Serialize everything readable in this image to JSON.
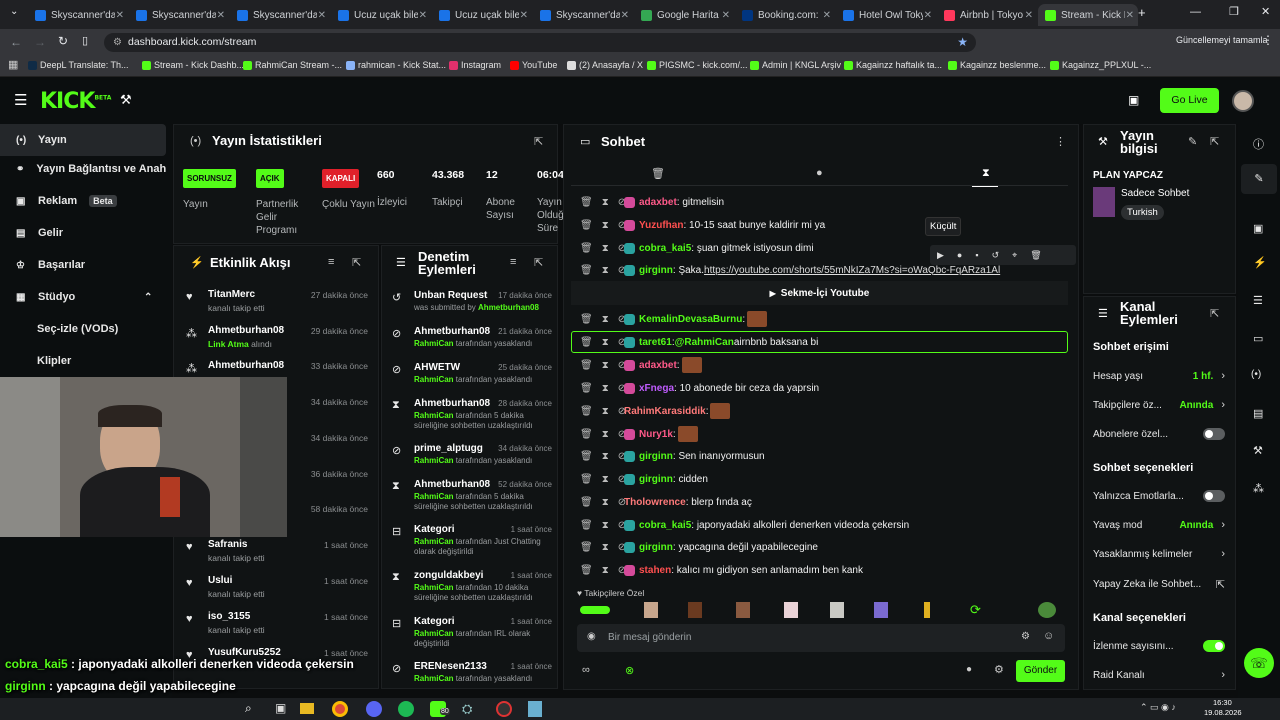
{
  "browser": {
    "tabs": [
      "Skyscanner'da",
      "Skyscanner'da",
      "Skyscanner'da",
      "Ucuz uçak bile",
      "Ucuz uçak bile",
      "Skyscanner'da",
      "Google Harita",
      "Booking.com: I",
      "Hotel Owl Toky",
      "Airbnb | Tokyo",
      "Stream - Kick D"
    ],
    "url": "dashboard.kick.com/stream",
    "update_label": "Güncellemeyi tamamla",
    "bookmarks": [
      "DeepL Translate: Th...",
      "Stream - Kick Dashb...",
      "RahmiCan Stream -...",
      "rahmican - Kick Stat...",
      "Instagram",
      "YouTube",
      "(2) Anasayfa / X",
      "PIGSMC - kick.com/...",
      "Admin | KNGL Arşiv",
      "Kagainzz haftalık ta...",
      "Kagainzz beslenme...",
      "Kagainzz_PPLXUL -..."
    ]
  },
  "header": {
    "logo": "KICK",
    "logo_sup": "BETA",
    "golive": "Go Live"
  },
  "sidebar": {
    "items": [
      "Yayın",
      "Yayın Bağlantısı ve Anahtarı",
      "Reklam",
      "Gelir",
      "Başarılar",
      "Stüdyo",
      "Seç-izle (VODs)",
      "Klipler"
    ],
    "beta": "Beta"
  },
  "stats": {
    "title": "Yayın İstatistikleri",
    "cols": [
      {
        "badge": "SORUNSUZ",
        "label": "Yayın"
      },
      {
        "badge": "AÇIK",
        "label": "Partnerlik Gelir Programı"
      },
      {
        "badge": "KAPALI",
        "label": "Çoklu Yayın"
      },
      {
        "num": "660",
        "label": "İzleyici"
      },
      {
        "num": "43.368",
        "label": "Takipçi"
      },
      {
        "num": "12",
        "label": "Abone Sayısı"
      },
      {
        "num": "06:04",
        "label": "Yayın Olduğu Süre"
      }
    ]
  },
  "events": {
    "title": "Etkinlik Akışı",
    "items": [
      {
        "name": "TitanMerc",
        "time": "27 dakika önce",
        "sub": "kanalı takip etti",
        "hl": ""
      },
      {
        "name": "Ahmetburhan08",
        "time": "29 dakika önce",
        "sub": "alındı",
        "hl": "Link Atma"
      },
      {
        "name": "Ahmetburhan08",
        "time": "33 dakika önce",
        "sub": "",
        "hl": ""
      },
      {
        "name": "",
        "time": "34 dakika önce",
        "sub": "",
        "hl": ""
      },
      {
        "name": "",
        "time": "34 dakika önce",
        "sub": "",
        "hl": ""
      },
      {
        "name": "",
        "time": "36 dakika önce",
        "sub": "",
        "hl": ""
      },
      {
        "name": "",
        "time": "58 dakika önce",
        "sub": "",
        "hl": ""
      },
      {
        "name": "Safranis",
        "time": "1 saat önce",
        "sub": "kanalı takip etti",
        "hl": ""
      },
      {
        "name": "Uslui",
        "time": "1 saat önce",
        "sub": "kanalı takip etti",
        "hl": ""
      },
      {
        "name": "iso_3155",
        "time": "1 saat önce",
        "sub": "kanalı takip etti",
        "hl": ""
      },
      {
        "name": "YusufKuru5252",
        "time": "1 saat önce",
        "sub": "",
        "hl": ""
      }
    ]
  },
  "moderation": {
    "title": "Denetim Eylemleri",
    "items": [
      {
        "name": "Unban Request",
        "time": "17 dakika önce",
        "pre": "was submitted by ",
        "hl": "Ahmetburhan08",
        "post": ""
      },
      {
        "name": "Ahmetburhan08",
        "time": "21 dakika önce",
        "pre": "",
        "hl": "RahmiCan",
        "post": " tarafından yasaklandı"
      },
      {
        "name": "AHWETW",
        "time": "25 dakika önce",
        "pre": "",
        "hl": "RahmiCan",
        "post": " tarafından yasaklandı"
      },
      {
        "name": "Ahmetburhan08",
        "time": "28 dakika önce",
        "pre": "",
        "hl": "RahmiCan",
        "post": " tarafından 5 dakika süreliğine sohbetten uzaklaştırıldı"
      },
      {
        "name": "prime_alptugg",
        "time": "34 dakika önce",
        "pre": "",
        "hl": "RahmiCan",
        "post": " tarafından yasaklandı"
      },
      {
        "name": "Ahmetburhan08",
        "time": "52 dakika önce",
        "pre": "",
        "hl": "RahmiCan",
        "post": " tarafından 5 dakika süreliğine sohbetten uzaklaştırıldı"
      },
      {
        "name": "Kategori",
        "time": "1 saat önce",
        "pre": "",
        "hl": "RahmiCan",
        "post": " tarafından Just Chatting olarak değiştirildi"
      },
      {
        "name": "zonguldakbeyi",
        "time": "1 saat önce",
        "pre": "",
        "hl": "RahmiCan",
        "post": " tarafından 10 dakika süreliğine sohbetten uzaklaştırıldı"
      },
      {
        "name": "Kategori",
        "time": "1 saat önce",
        "pre": "",
        "hl": "RahmiCan",
        "post": " tarafından IRL olarak değiştirildi"
      },
      {
        "name": "ERENesen2133",
        "time": "1 saat önce",
        "pre": "",
        "hl": "RahmiCan",
        "post": " tarafından yasaklandı"
      }
    ]
  },
  "chat": {
    "title": "Sohbet",
    "tooltip": "Küçült",
    "youtube_btn": "Sekme-İçi Youtube",
    "follower_label": "Takipçilere Özel",
    "placeholder": "Bir mesaj gönderin",
    "send": "Gönder",
    "messages": [
      {
        "user": "adaxbet",
        "color": "#ff5a8a",
        "text": ": gitmelisin",
        "emote": false
      },
      {
        "user": "Yuzufhan",
        "color": "#ff5050",
        "text": ": 10-15 saat bunye kaldirir mi ya",
        "emote": false
      },
      {
        "user": "cobra_kai5",
        "color": "#53fc18",
        "text": ": şuan gitmek istiyosun dimi",
        "emote": false
      },
      {
        "user": "girginn",
        "color": "#53fc18",
        "text": ": Şaka. ",
        "link": "https://youtube.com/shorts/55mNkIZa7Ms?si=oWaQbc-FqARza1Al",
        "emote": false
      },
      {
        "user": "KemalinDevasaBurnu",
        "color": "#53fc18",
        "text": ":",
        "emote": true
      },
      {
        "user": "taret61",
        "color": "#53fc18",
        "text": ": ",
        "mention": "@RahmiCan",
        "rest": " airnbnb baksana bi",
        "emote": false
      },
      {
        "user": "adaxbet",
        "color": "#ff5a8a",
        "text": ":",
        "emote": true
      },
      {
        "user": "xFnega",
        "color": "#c05cff",
        "text": ": 10 abonede bir ceza da yaprsin",
        "emote": false
      },
      {
        "user": "RahimKarasiddik",
        "color": "#ff7a7a",
        "text": ":",
        "emote": true
      },
      {
        "user": "Nury1k",
        "color": "#ff5a8a",
        "text": ":",
        "emote": true
      },
      {
        "user": "girginn",
        "color": "#53fc18",
        "text": ": Sen inanıyormusun",
        "emote": false
      },
      {
        "user": "girginn",
        "color": "#53fc18",
        "text": ": cidden",
        "emote": false
      },
      {
        "user": "Tholowrence",
        "color": "#ff7a7a",
        "text": ": blerp fında aç",
        "emote": false
      },
      {
        "user": "cobra_kai5",
        "color": "#53fc18",
        "text": ": japonyadaki alkolleri denerken videoda çekersin",
        "emote": false
      },
      {
        "user": "girginn",
        "color": "#53fc18",
        "text": ": yapcagına değil yapabilecegine",
        "emote": false
      },
      {
        "user": "stahen",
        "color": "#ff5050",
        "text": ": kalıcı mı gidiyon sen anlamadım ben kank",
        "emote": false
      }
    ]
  },
  "info": {
    "title": "Yayın bilgisi",
    "stream_title": "PLAN YAPCAZ",
    "category": "Sadece Sohbet",
    "tag": "Turkish"
  },
  "channel": {
    "title": "Kanal Eylemleri",
    "access_head": "Sohbet erişimi",
    "access": [
      {
        "label": "Hesap yaşı",
        "value": "1 hf."
      },
      {
        "label": "Takipçilere öz...",
        "value": "Anında"
      },
      {
        "label": "Abonelere özel...",
        "toggle": false
      }
    ],
    "options_head": "Sohbet seçenekleri",
    "options": [
      {
        "label": "Yalnızca Emotlarla...",
        "toggle": false
      },
      {
        "label": "Yavaş mod",
        "value": "Anında"
      },
      {
        "label": "Yasaklanmış kelimeler",
        "value": ""
      },
      {
        "label": "Yapay Zeka ile Sohbet...",
        "value": ""
      }
    ],
    "kanal_head": "Kanal seçenekleri",
    "kanal": [
      {
        "label": "İzlenme sayısını...",
        "toggle": true
      },
      {
        "label": "Raid Kanalı",
        "value": ""
      }
    ]
  },
  "overlay": [
    {
      "user": "cobra_kai5",
      "text": " : japonyadaki alkolleri denerken videoda çekersin"
    },
    {
      "user": "girginn",
      "text": " : yapcagına değil yapabilecegine"
    },
    {
      "user": "stahen",
      "text": " : kalıcı mı gidiyon sen anlamadım ben kank"
    }
  ],
  "taskbar": {
    "time": "16:30",
    "date": "19.08.2026",
    "badge": "80"
  },
  "colors": {
    "accent": "#53fc18",
    "bg": "#0b0e0f",
    "panel": "#101314"
  }
}
